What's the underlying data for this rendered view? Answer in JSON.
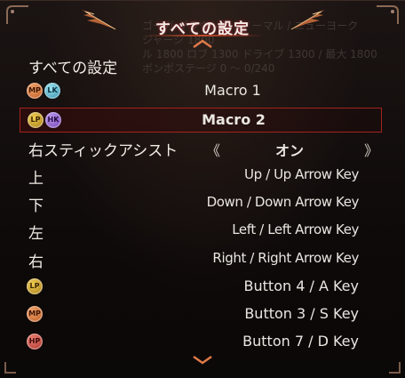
{
  "window": {
    "title": "すべての設定"
  },
  "background_text": [
    "ゴーガ グラウンド / ノーマル / ニューヨーク",
    "ジャージ 1800",
    "ル 1800 ロブ 1300 ドライブ 1300 / 最大 1800",
    "ボンポステージ 0 ～ 0/240"
  ],
  "section": {
    "label": "すべての設定"
  },
  "rows": [
    {
      "label": "",
      "badges": [
        "MP",
        "LK"
      ],
      "value": "Macro 1",
      "selected": false
    },
    {
      "label": "",
      "badges": [
        "LP",
        "HK"
      ],
      "value": "Macro 2",
      "selected": true
    },
    {
      "label": "右スティックアシスト",
      "badges": [],
      "value": "オン",
      "selected": false,
      "has_arrows": true
    },
    {
      "label": "上",
      "badges": [],
      "value": "Up / Up Arrow Key",
      "selected": false
    },
    {
      "label": "下",
      "badges": [],
      "value": "Down / Down Arrow Key",
      "selected": false
    },
    {
      "label": "左",
      "badges": [],
      "value": "Left / Left Arrow Key",
      "selected": false
    },
    {
      "label": "右",
      "badges": [],
      "value": "Right / Right Arrow Key",
      "selected": false
    },
    {
      "label": "",
      "badges": [
        "LP"
      ],
      "value": "Button 4 / A Key",
      "selected": false
    },
    {
      "label": "",
      "badges": [
        "MP"
      ],
      "value": "Button 3 / S Key",
      "selected": false
    },
    {
      "label": "",
      "badges": [
        "HP"
      ],
      "value": "Button 7 / D Key",
      "selected": false
    }
  ],
  "arrows": {
    "left": "《",
    "right": "》"
  },
  "colors": {
    "accent": "#a4231f",
    "title_glow": "#aa2233",
    "wing": "#c46a3a"
  }
}
